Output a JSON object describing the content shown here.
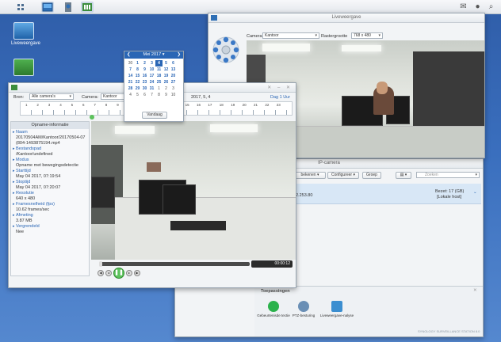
{
  "liveview": {
    "title": "Liveweergave",
    "camera_label": "Camera",
    "camera_value": "Kantoor",
    "raster_label": "Rastergrootte",
    "raster_value": "768 x 480"
  },
  "desktop": {
    "icons": [
      {
        "label": "Liveweergave"
      }
    ]
  },
  "calendar": {
    "month_label": "Mei 2017",
    "rows": [
      [
        "30",
        "1",
        "2",
        "3",
        "4",
        "5",
        "6"
      ],
      [
        "7",
        "8",
        "9",
        "10",
        "11",
        "12",
        "13"
      ],
      [
        "14",
        "15",
        "16",
        "17",
        "18",
        "19",
        "20"
      ],
      [
        "21",
        "22",
        "23",
        "24",
        "25",
        "26",
        "27"
      ],
      [
        "28",
        "29",
        "30",
        "31",
        "1",
        "2",
        "3"
      ],
      [
        "4",
        "5",
        "6",
        "7",
        "8",
        "9",
        "10"
      ]
    ],
    "selected_day": "4",
    "today_label": "Vandaag"
  },
  "player": {
    "bron_label": "Bron:",
    "bron_value": "Alle camera's",
    "camera_label": "Camera:",
    "camera_value": "Kantoor",
    "date_value": "2017, 5, 4",
    "range_value": "Dag 1 Uur",
    "timeline_ticks": [
      "1",
      "2",
      "3",
      "4",
      "5",
      "6",
      "7",
      "8",
      "9",
      "10",
      "11",
      "12",
      "13",
      "14",
      "15",
      "16",
      "17",
      "18",
      "19",
      "20",
      "21",
      "22",
      "23"
    ],
    "time_display": "00:00:12",
    "info_title": "Opname-informatie",
    "info": [
      {
        "label": "Naam",
        "value": "20170504AM/Kantoor/20170504-07(804-1493875194.mp4"
      },
      {
        "label": "Bestandspad",
        "value": "/Kantoor/undefined"
      },
      {
        "label": "Modus",
        "value": "Opname met bewegingsdetectie"
      },
      {
        "label": "Starttijd",
        "value": "May 04 2017, 07:19:54"
      },
      {
        "label": "Stoptijd",
        "value": "May 04 2017, 07:20:07"
      },
      {
        "label": "Resolutie",
        "value": "640 x 480"
      },
      {
        "label": "Framesnelheid (fps)",
        "value": "10.62 frames/sec"
      },
      {
        "label": "Afmeting",
        "value": "3.87 MB"
      },
      {
        "label": "Vergrendeld",
        "value": "Nee"
      }
    ]
  },
  "ipcam": {
    "title": "IP-camera",
    "configure": "Configureer",
    "group": "Groep",
    "search_placeholder": "Zoeken",
    "ip_partial": "2.253.80",
    "status": "Bezet: 17 (GB)",
    "status2": "[Lokale host]"
  },
  "apps": {
    "title": "Toepassingen",
    "items": [
      {
        "label": "Gebeurtenisde tectie",
        "color": "#2bb24c"
      },
      {
        "label": "PTZ-besturing",
        "color": "#6a8fb5"
      },
      {
        "label": "Liveweergave-nalyse",
        "color": "#3b8ed0"
      }
    ]
  },
  "brand": "SYNOLOGY SURVEILLANCE STATION 8.0"
}
